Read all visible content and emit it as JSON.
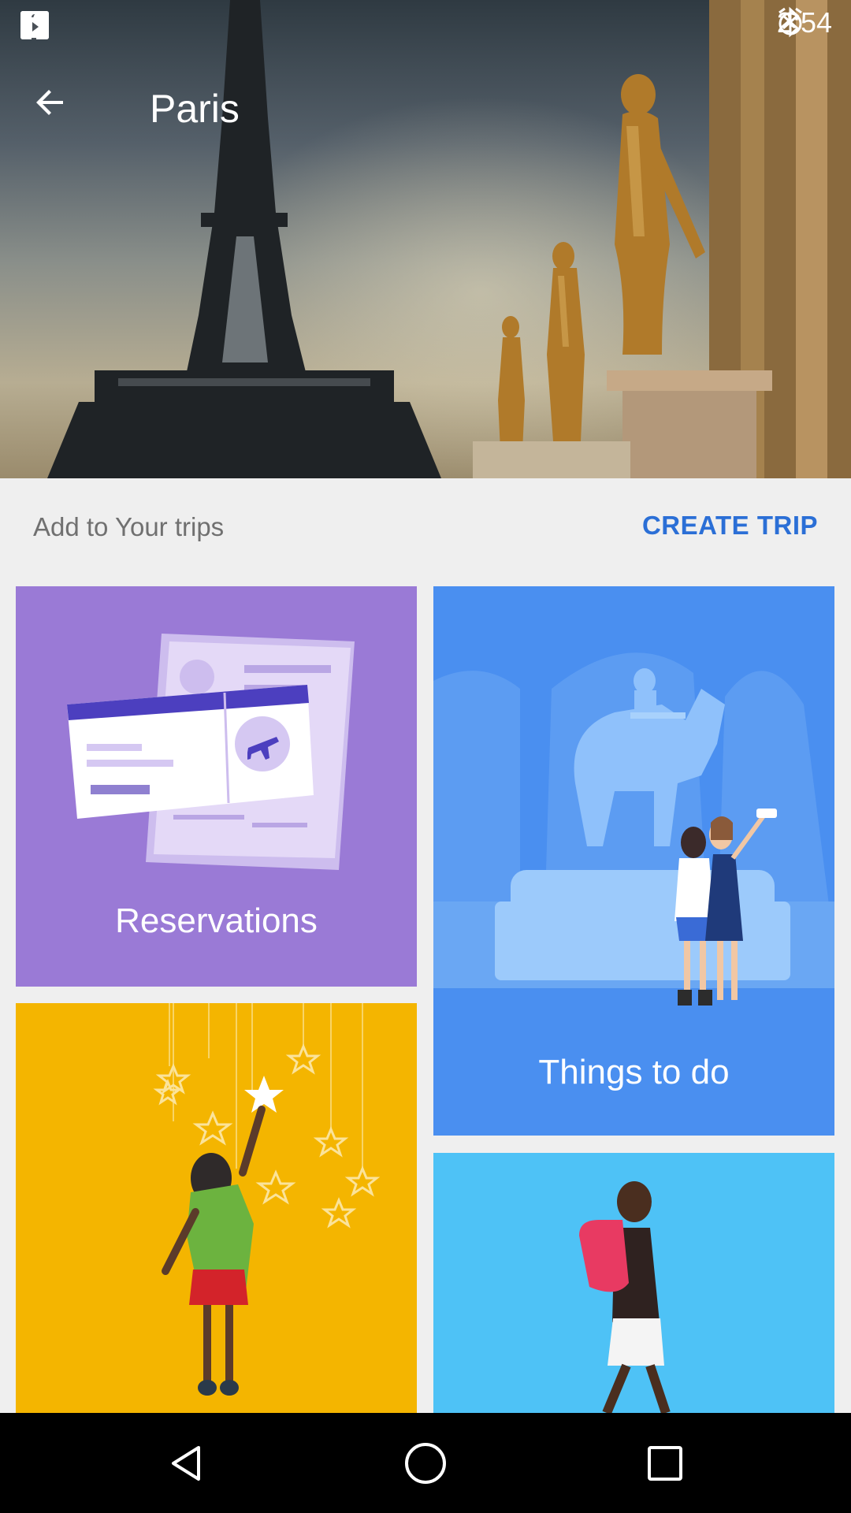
{
  "status_bar": {
    "time": "2:54",
    "left_icons": [
      "facebook-icon",
      "facebook-icon",
      "wrench-icon",
      "satellite-icon",
      "lock-icon",
      "bag-icon",
      "inbox-check-icon",
      "briefcase-icon"
    ],
    "right_icons": [
      "bluetooth-icon",
      "alarm-icon"
    ]
  },
  "app_bar": {
    "title": "Paris",
    "back_icon": "arrow-back-icon"
  },
  "trips": {
    "label": "Add to Your trips",
    "create_label": "CREATE TRIP"
  },
  "cards": {
    "reservations": {
      "label": "Reservations"
    },
    "things_to_do": {
      "label": "Things to do"
    }
  },
  "nav": {
    "icons": [
      "back-triangle-icon",
      "home-circle-icon",
      "recents-square-icon"
    ]
  },
  "colors": {
    "accent": "#2b6fd6",
    "reservations_bg": "#9a7ad6",
    "things_to_do_bg": "#4a8ff0",
    "stars_bg": "#f4b500",
    "walk_bg": "#4ec2f6"
  }
}
